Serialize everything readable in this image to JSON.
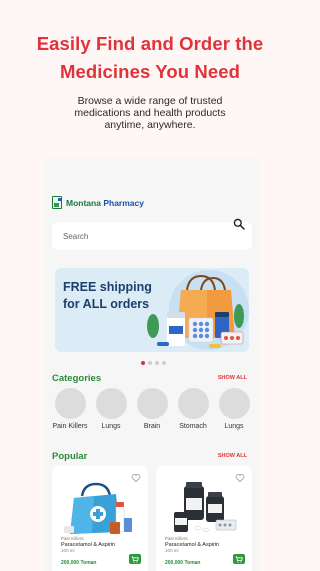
{
  "headline": {
    "line1": "Easily Find and Order the",
    "line2": "Medicines You Need"
  },
  "subheadline": {
    "line1": "Browse a wide range of trusted",
    "line2": "medications and health products",
    "line3": "anytime, anywhere."
  },
  "app": {
    "brand_part1": "Montana",
    "brand_part2": "Pharmacy",
    "search_placeholder": "Search",
    "banner": {
      "line1": "FREE shipping",
      "line2": "for ALL orders"
    },
    "categories": {
      "title": "Categories",
      "show_all": "SHOW ALL",
      "items": [
        {
          "label": "Pain Killers"
        },
        {
          "label": "Lungs"
        },
        {
          "label": "Brain"
        },
        {
          "label": "Stomach"
        },
        {
          "label": "Lungs"
        }
      ]
    },
    "popular": {
      "title": "Popular",
      "show_all": "SHOW ALL",
      "products": [
        {
          "category": "Pain Killers",
          "name": "Paracetamol & Aspirin",
          "size": "100 ml",
          "price": "200,000 Toman"
        },
        {
          "category": "Pain Killers",
          "name": "Paracetamol & Aspirin",
          "size": "100 ml",
          "price": "200,000 Toman"
        }
      ]
    }
  },
  "colors": {
    "accent_red": "#e0333a",
    "brand_green": "#2a8a3a",
    "brand_blue": "#1f4fa0",
    "banner_bg": "#dcecf7"
  }
}
